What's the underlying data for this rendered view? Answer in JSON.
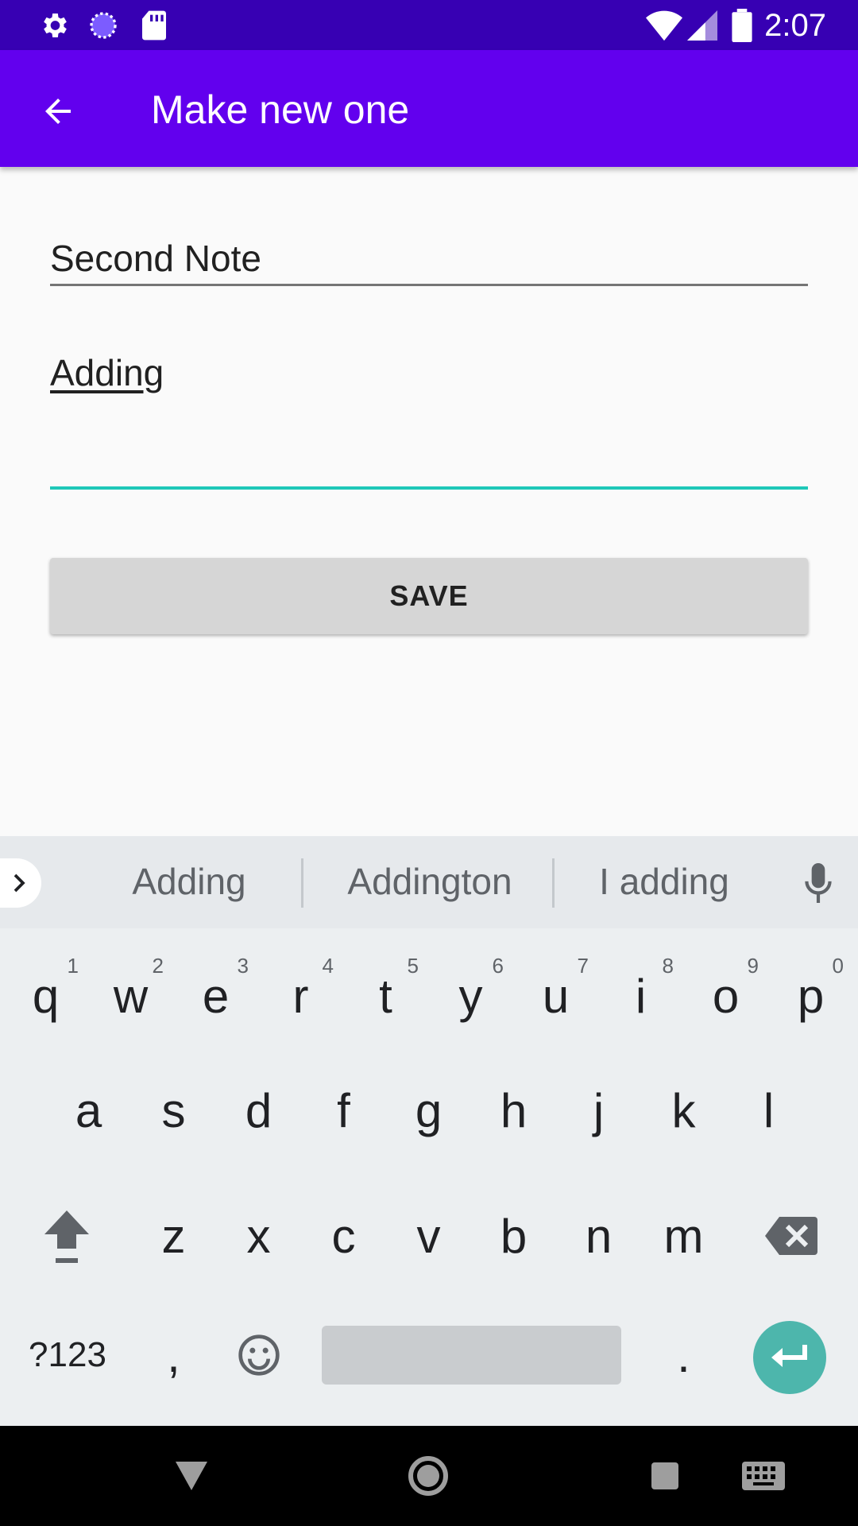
{
  "status_bar": {
    "time": "2:07",
    "icons": [
      "settings-icon",
      "sync-icon",
      "sd-card-icon",
      "wifi-icon",
      "signal-icon",
      "battery-icon"
    ]
  },
  "app_bar": {
    "back_icon": "arrow-back-icon",
    "title": "Make new one",
    "background": "#6200ee"
  },
  "form": {
    "title_value": "Second Note",
    "body_value": "Adding",
    "save_label": "SAVE",
    "accent": "#1ec8b8"
  },
  "keyboard": {
    "suggestions": [
      "Adding",
      "Addington",
      "I adding"
    ],
    "row1": [
      {
        "ch": "q",
        "hint": "1"
      },
      {
        "ch": "w",
        "hint": "2"
      },
      {
        "ch": "e",
        "hint": "3"
      },
      {
        "ch": "r",
        "hint": "4"
      },
      {
        "ch": "t",
        "hint": "5"
      },
      {
        "ch": "y",
        "hint": "6"
      },
      {
        "ch": "u",
        "hint": "7"
      },
      {
        "ch": "i",
        "hint": "8"
      },
      {
        "ch": "o",
        "hint": "9"
      },
      {
        "ch": "p",
        "hint": "0"
      }
    ],
    "row2": [
      "a",
      "s",
      "d",
      "f",
      "g",
      "h",
      "j",
      "k",
      "l"
    ],
    "row3": [
      "z",
      "x",
      "c",
      "v",
      "b",
      "n",
      "m"
    ],
    "symbols_label": "?123",
    "comma_label": ",",
    "period_label": ".",
    "enter_color": "#4db6ac"
  },
  "nav_bar": {
    "icons": [
      "back-triangle-icon",
      "home-circle-icon",
      "recents-square-icon",
      "keyboard-switch-icon"
    ]
  }
}
